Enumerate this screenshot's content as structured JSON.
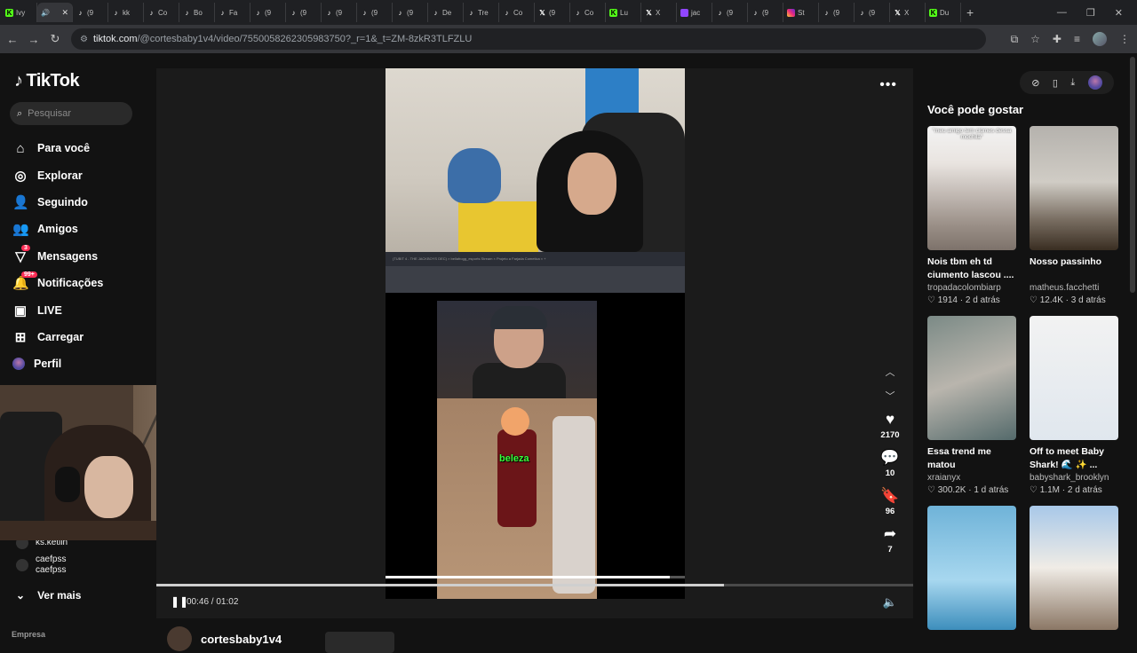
{
  "browser": {
    "tabs": [
      {
        "icon": "kick",
        "label": "Ivy",
        "active": false
      },
      {
        "icon": "audio",
        "label": "",
        "active": true
      },
      {
        "icon": "tiktok",
        "label": "(9",
        "active": false
      },
      {
        "icon": "tiktok",
        "label": "kk",
        "active": false
      },
      {
        "icon": "tiktok",
        "label": "Co",
        "active": false
      },
      {
        "icon": "tiktok",
        "label": "Bo",
        "active": false
      },
      {
        "icon": "tiktok",
        "label": "Fa",
        "active": false
      },
      {
        "icon": "tiktok",
        "label": "(9",
        "active": false
      },
      {
        "icon": "tiktok",
        "label": "(9",
        "active": false
      },
      {
        "icon": "tiktok",
        "label": "(9",
        "active": false
      },
      {
        "icon": "tiktok",
        "label": "(9",
        "active": false
      },
      {
        "icon": "tiktok",
        "label": "(9",
        "active": false
      },
      {
        "icon": "tiktok",
        "label": "De",
        "active": false
      },
      {
        "icon": "tiktok",
        "label": "Tre",
        "active": false
      },
      {
        "icon": "tiktok",
        "label": "Co",
        "active": false
      },
      {
        "icon": "x",
        "label": "(9",
        "active": false
      },
      {
        "icon": "tiktok",
        "label": "Co",
        "active": false
      },
      {
        "icon": "kick",
        "label": "Lu",
        "active": false
      },
      {
        "icon": "x",
        "label": "X",
        "active": false
      },
      {
        "icon": "twitch",
        "label": "jac",
        "active": false
      },
      {
        "icon": "tiktok",
        "label": "(9",
        "active": false
      },
      {
        "icon": "tiktok",
        "label": "(9",
        "active": false
      },
      {
        "icon": "insta",
        "label": "St",
        "active": false
      },
      {
        "icon": "tiktok",
        "label": "(9",
        "active": false
      },
      {
        "icon": "tiktok",
        "label": "(9",
        "active": false
      },
      {
        "icon": "x",
        "label": "X",
        "active": false
      },
      {
        "icon": "kick",
        "label": "Du",
        "active": false
      }
    ],
    "url_host": "tiktok.com",
    "url_path": "/@cortesbaby1v4/video/7550058262305983750?_r=1&_t=ZM-8zkR3TLFZLU"
  },
  "sidebar": {
    "logo": "TikTok",
    "search_placeholder": "Pesquisar",
    "nav": [
      {
        "icon": "home-icon",
        "glyph": "⌂",
        "label": "Para você"
      },
      {
        "icon": "compass-icon",
        "glyph": "◎",
        "label": "Explorar"
      },
      {
        "icon": "following-icon",
        "glyph": "👤",
        "label": "Seguindo"
      },
      {
        "icon": "friends-icon",
        "glyph": "👥",
        "label": "Amigos"
      },
      {
        "icon": "messages-icon",
        "glyph": "▽",
        "label": "Mensagens",
        "badge": "3"
      },
      {
        "icon": "notifications-icon",
        "glyph": "🔔",
        "label": "Notificações",
        "badge": "99+"
      },
      {
        "icon": "live-icon",
        "glyph": "▣",
        "label": "LIVE"
      },
      {
        "icon": "upload-icon",
        "glyph": "⊞",
        "label": "Carregar"
      },
      {
        "icon": "profile-icon",
        "glyph": "",
        "label": "Perfil"
      }
    ],
    "following": [
      {
        "name": "ks.ketlin",
        "handle": ""
      },
      {
        "name": "caefpss",
        "handle": "caefpss"
      }
    ],
    "see_more": "Ver mais",
    "footer": "Empresa"
  },
  "video": {
    "overlay_caption": "beleza",
    "taskbar_text": "(TUBIT 4 - THE JACKBOYS DEC)   ×   bellafrogg_esports Stream   ×   Projeto a Farjada Cometica ×   +",
    "progress_fraction": 0.95,
    "likes": "2170",
    "comments": "10",
    "saves": "96",
    "shares": "7",
    "time": "00:46 / 01:02",
    "seek_fraction": 0.75,
    "author": "cortesbaby1v4"
  },
  "recommendations": {
    "title": "Você pode gostar",
    "items": [
      {
        "thumb": "t1",
        "thumb_caption": "\"meu amigo tem ciúmes dessa mochila\"",
        "title": "Nois tbm eh td ciumento lascou ....",
        "user": "tropadacolombiarp",
        "likes": "1914",
        "age": "2 d atrás"
      },
      {
        "thumb": "t2",
        "thumb_caption": "",
        "title": "Nosso passinho",
        "user": "matheus.facchetti",
        "likes": "12.4K",
        "age": "3 d atrás"
      },
      {
        "thumb": "t3",
        "thumb_caption": "",
        "title": "Essa trend me matou",
        "user": "xraianyx",
        "likes": "300.2K",
        "age": "1 d atrás"
      },
      {
        "thumb": "t4",
        "thumb_caption": "",
        "title": "Off to meet Baby Shark! 🌊 ✨ ...",
        "user": "babyshark_brooklyn",
        "likes": "1.1M",
        "age": "2 d atrás"
      },
      {
        "thumb": "t5",
        "thumb_caption": "",
        "title": "",
        "user": "",
        "likes": "",
        "age": ""
      },
      {
        "thumb": "t6",
        "thumb_caption": "",
        "title": "",
        "user": "",
        "likes": "",
        "age": ""
      }
    ]
  },
  "colors": {
    "accent": "#fe2c55",
    "caption_green": "#38ff3a",
    "kick_green": "#53fc18"
  }
}
